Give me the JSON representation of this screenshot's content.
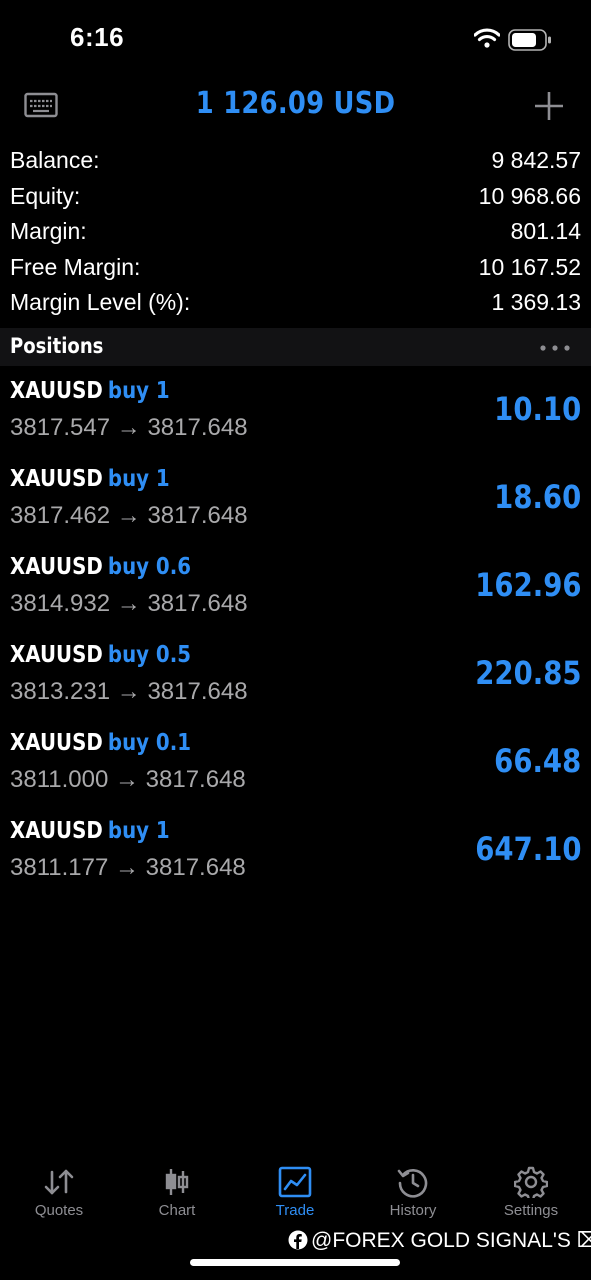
{
  "status": {
    "time": "6:16"
  },
  "header": {
    "title": "1 126.09 USD"
  },
  "summary": [
    {
      "label": "Balance:",
      "value": "9 842.57"
    },
    {
      "label": "Equity:",
      "value": "10 968.66"
    },
    {
      "label": "Margin:",
      "value": "801.14"
    },
    {
      "label": "Free Margin:",
      "value": "10 167.52"
    },
    {
      "label": "Margin Level (%):",
      "value": "1 369.13"
    }
  ],
  "positions_header": {
    "title": "Positions"
  },
  "positions": [
    {
      "symbol": "XAUUSD",
      "side": "buy 1",
      "prices": "3817.547 → 3817.648",
      "profit": "10.10"
    },
    {
      "symbol": "XAUUSD",
      "side": "buy 1",
      "prices": "3817.462 → 3817.648",
      "profit": "18.60"
    },
    {
      "symbol": "XAUUSD",
      "side": "buy 0.6",
      "prices": "3814.932 → 3817.648",
      "profit": "162.96"
    },
    {
      "symbol": "XAUUSD",
      "side": "buy 0.5",
      "prices": "3813.231 → 3817.648",
      "profit": "220.85"
    },
    {
      "symbol": "XAUUSD",
      "side": "buy 0.1",
      "prices": "3811.000 → 3817.648",
      "profit": "66.48"
    },
    {
      "symbol": "XAUUSD",
      "side": "buy 1",
      "prices": "3811.177 → 3817.648",
      "profit": "647.10"
    }
  ],
  "tabs": [
    {
      "label": "Quotes",
      "icon": "quotes-arrows-icon"
    },
    {
      "label": "Chart",
      "icon": "candlestick-chart-icon"
    },
    {
      "label": "Trade",
      "icon": "trade-chart-icon",
      "active": true
    },
    {
      "label": "History",
      "icon": "history-clock-icon"
    },
    {
      "label": "Settings",
      "icon": "gear-icon"
    }
  ],
  "watermark": {
    "text": "@FOREX GOLD SIGNAL'S ⌧"
  },
  "colors": {
    "accent": "#2f8ef4",
    "muted": "#a9a9ab",
    "background": "#000000"
  }
}
